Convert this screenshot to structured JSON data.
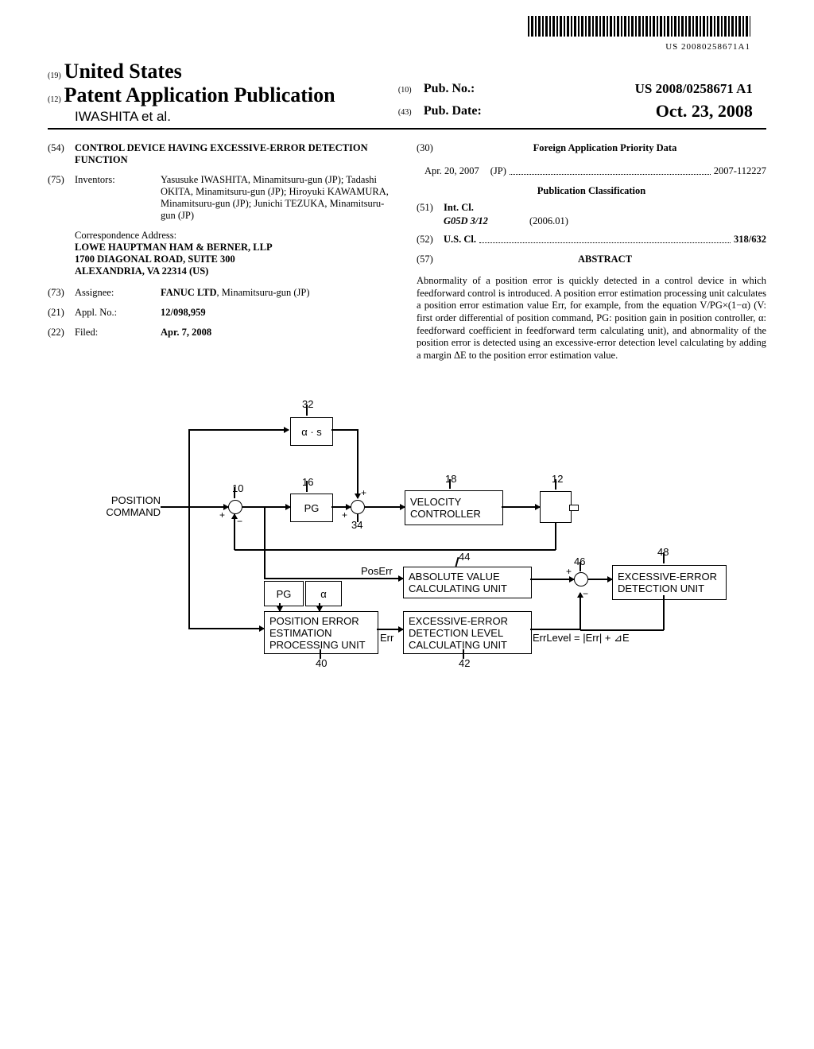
{
  "barcode_text": "US 20080258671A1",
  "header": {
    "code19": "(19)",
    "country": "United States",
    "code12": "(12)",
    "pub_type": "Patent Application Publication",
    "authors_line": "IWASHITA et al.",
    "code10": "(10)",
    "pubno_label": "Pub. No.:",
    "pubno_value": "US 2008/0258671 A1",
    "code43": "(43)",
    "pubdate_label": "Pub. Date:",
    "pubdate_value": "Oct. 23, 2008"
  },
  "left": {
    "code54": "(54)",
    "title": "CONTROL DEVICE HAVING EXCESSIVE-ERROR DETECTION FUNCTION",
    "code75": "(75)",
    "inventors_label": "Inventors:",
    "inventors_value": "Yasusuke IWASHITA, Minamitsuru-gun (JP); Tadashi OKITA, Minamitsuru-gun (JP); Hiroyuki KAWAMURA, Minamitsuru-gun (JP); Junichi TEZUKA, Minamitsuru-gun (JP)",
    "corr_label": "Correspondence Address:",
    "corr_line1": "LOWE HAUPTMAN HAM & BERNER, LLP",
    "corr_line2": "1700 DIAGONAL ROAD, SUITE 300",
    "corr_line3": "ALEXANDRIA, VA 22314 (US)",
    "code73": "(73)",
    "assignee_label": "Assignee:",
    "assignee_value": "FANUC LTD, Minamitsuru-gun (JP)",
    "code21": "(21)",
    "applno_label": "Appl. No.:",
    "applno_value": "12/098,959",
    "code22": "(22)",
    "filed_label": "Filed:",
    "filed_value": "Apr. 7, 2008"
  },
  "right": {
    "code30": "(30)",
    "foreign_heading": "Foreign Application Priority Data",
    "foreign_date": "Apr. 20, 2007",
    "foreign_country": "(JP)",
    "foreign_number": "2007-112227",
    "pub_class_heading": "Publication Classification",
    "code51": "(51)",
    "intcl_label": "Int. Cl.",
    "intcl_class": "G05D 3/12",
    "intcl_date": "(2006.01)",
    "code52": "(52)",
    "uscl_label": "U.S. Cl.",
    "uscl_value": "318/632",
    "code57": "(57)",
    "abstract_heading": "ABSTRACT",
    "abstract_text": "Abnormality of a position error is quickly detected in a control device in which feedforward control is introduced. A position error estimation processing unit calculates a position error estimation value Err, for example, from the equation V/PG×(1−α) (V: first order differential of position command, PG: position gain in position controller, α: feedforward coefficient in feedforward term calculating unit), and abnormality of the position error is detected using an excessive-error detection level calculating by adding a margin ΔE to the position error estimation value."
  },
  "figure": {
    "input_label": "POSITION COMMAND",
    "ref32": "32",
    "box32": "α · s",
    "ref10": "10",
    "ref16": "16",
    "box16": "PG",
    "ref34": "34",
    "ref18": "18",
    "box18": "VELOCITY CONTROLLER",
    "ref12": "12",
    "poserr": "PosErr",
    "pg_param": "PG",
    "alpha_param": "α",
    "ref40": "40",
    "box40": "POSITION ERROR ESTIMATION PROCESSING UNIT",
    "err": "Err",
    "ref44": "44",
    "box44": "ABSOLUTE VALUE CALCULATING UNIT",
    "ref42": "42",
    "box42": "EXCESSIVE-ERROR DETECTION LEVEL CALCULATING UNIT",
    "ref46": "46",
    "ref48": "48",
    "box48": "EXCESSIVE-ERROR DETECTION UNIT",
    "errlevel": "ErrLevel = |Err| + ⊿E"
  }
}
